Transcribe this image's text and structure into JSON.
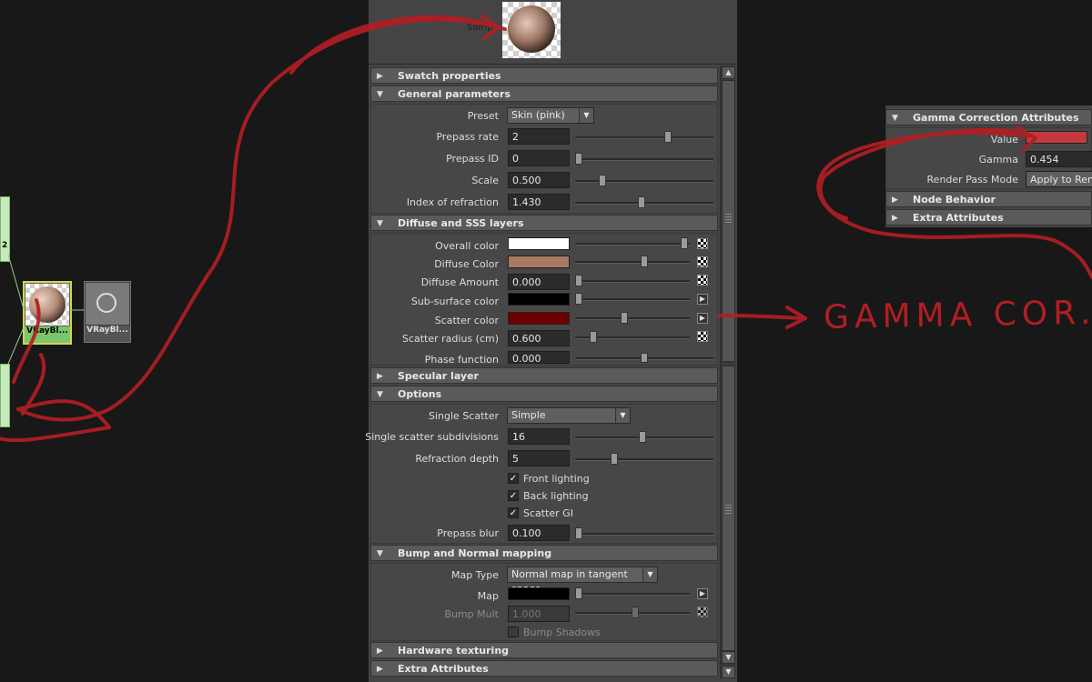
{
  "colors": {
    "scribble": "#b11e24",
    "accent_selected": "#d7d15a",
    "node_green": "#7cc56b"
  },
  "node_graph": {
    "nodes": [
      {
        "label": "VRayBl...",
        "selected": true
      },
      {
        "label": "VRayBl...",
        "selected": false
      }
    ],
    "partial_node_label": "2"
  },
  "swatch": {
    "label": "Samp"
  },
  "sections": {
    "swatch_properties": "Swatch properties",
    "general_parameters": "General parameters",
    "diffuse_sss": "Diffuse and SSS layers",
    "specular": "Specular layer",
    "options": "Options",
    "bump": "Bump and Normal mapping",
    "hardware": "Hardware texturing",
    "extra": "Extra Attributes"
  },
  "general": {
    "preset_label": "Preset",
    "preset_value": "Skin (pink)",
    "prepass_rate_label": "Prepass rate",
    "prepass_rate": "2",
    "prepass_rate_level": 0.68,
    "prepass_id_label": "Prepass ID",
    "prepass_id": "0",
    "prepass_id_level": 0.0,
    "scale_label": "Scale",
    "scale": "0.500",
    "scale_level": 0.18,
    "ior_label": "Index of refraction",
    "ior": "1.430",
    "ior_level": 0.48
  },
  "diffuse": {
    "overall_label": "Overall color",
    "overall_color": "#ffffff",
    "diffuse_color_label": "Diffuse Color",
    "diffuse_color": "#a87a63",
    "diffuse_amount_label": "Diffuse Amount",
    "diffuse_amount": "0.000",
    "sss_color_label": "Sub-surface color",
    "sss_color": "#000000",
    "scatter_color_label": "Scatter color",
    "scatter_color": "#6b0000",
    "scatter_radius_label": "Scatter radius (cm)",
    "scatter_radius": "0.600",
    "phase_label": "Phase function",
    "phase": "0.000"
  },
  "options": {
    "single_scatter_label": "Single Scatter",
    "single_scatter": "Simple",
    "subdiv_label": "Single scatter subdivisions",
    "subdiv": "16",
    "refr_depth_label": "Refraction depth",
    "refr_depth": "5",
    "front_lighting": "Front lighting",
    "back_lighting": "Back lighting",
    "scatter_gi": "Scatter GI",
    "prepass_blur_label": "Prepass blur",
    "prepass_blur": "0.100"
  },
  "bump": {
    "map_type_label": "Map Type",
    "map_type": "Normal map in tangent space",
    "map_label": "Map",
    "bump_mult_label": "Bump Mult",
    "bump_mult": "1.000",
    "bump_shadows": "Bump Shadows"
  },
  "gamma_panel": {
    "title": "Gamma Correction Attributes",
    "value_label": "Value",
    "value_color": "#c4393d",
    "gamma_label": "Gamma",
    "gamma": "0.454",
    "render_pass_label": "Render Pass Mode",
    "render_pass": "Apply to Render",
    "node_behavior": "Node Behavior",
    "extra_attributes": "Extra Attributes"
  },
  "annotation": {
    "text": "GAMMA COR..."
  }
}
